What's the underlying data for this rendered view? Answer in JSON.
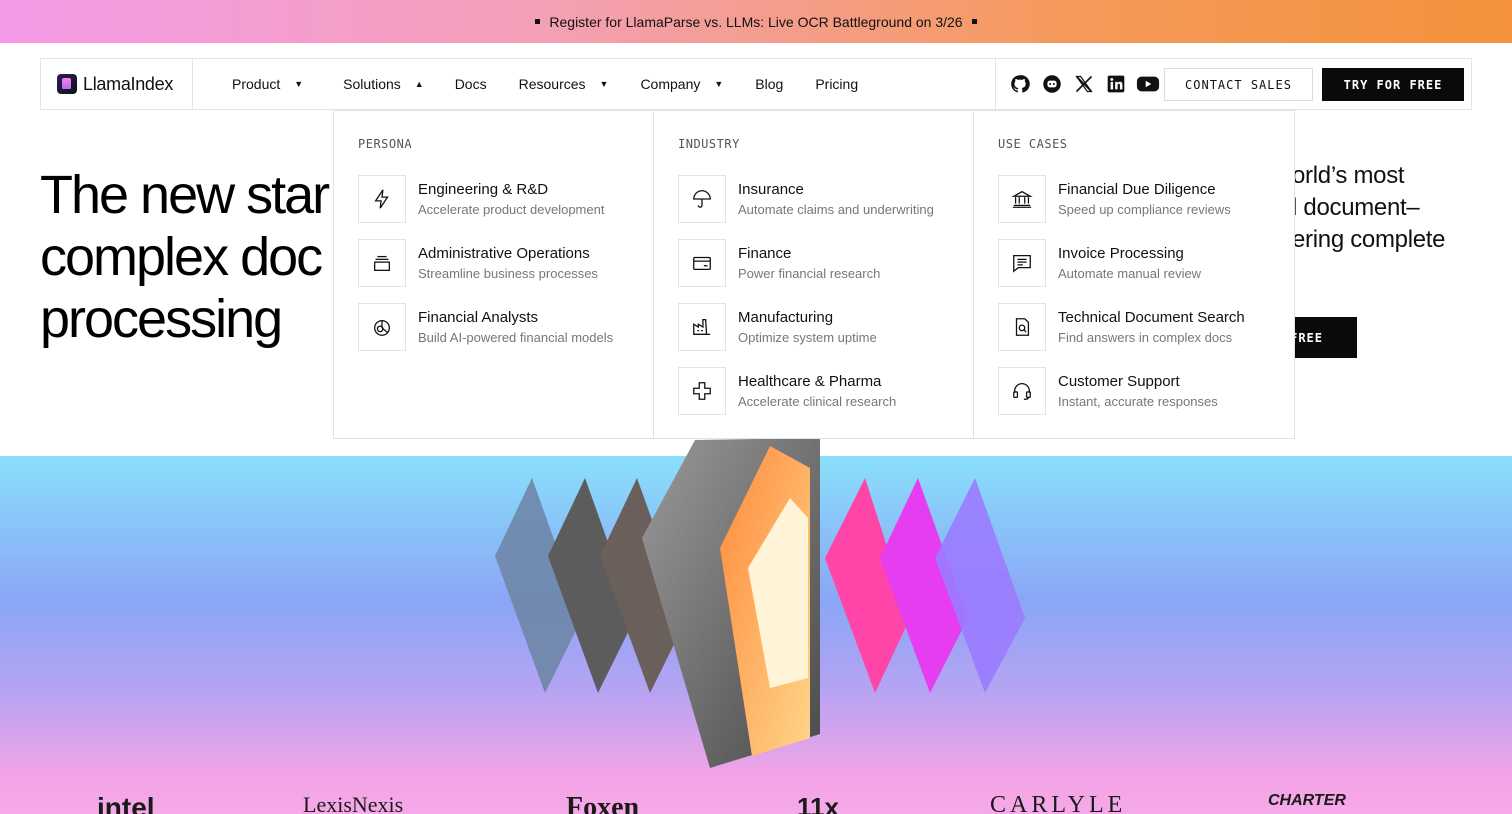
{
  "banner": {
    "text": "Register for LlamaParse vs. LLMs: Live OCR Battleground on 3/26"
  },
  "nav": {
    "logo_text": "LlamaIndex",
    "items": [
      {
        "label": "Product",
        "caret": "▼"
      },
      {
        "label": "Solutions",
        "caret": "▲"
      },
      {
        "label": "Docs"
      },
      {
        "label": "Resources",
        "caret": "▼"
      },
      {
        "label": "Company",
        "caret": "▼"
      },
      {
        "label": "Blog"
      },
      {
        "label": "Pricing"
      }
    ],
    "social_icons": [
      "github-icon",
      "discord-icon",
      "x-icon",
      "linkedin-icon",
      "youtube-icon"
    ],
    "contact_label": "CONTACT SALES",
    "try_label": "TRY FOR FREE"
  },
  "hero": {
    "title_lines": [
      "The new star",
      "complex doc",
      "processing"
    ],
    "sub_lines": [
      "orld’s most",
      "l document–",
      "ering complete"
    ],
    "cta_label": "FREE"
  },
  "dropdown": {
    "columns": [
      {
        "heading": "PERSONA",
        "items": [
          {
            "icon": "lightning-icon",
            "title": "Engineering & R&D",
            "desc": "Accelerate product development"
          },
          {
            "icon": "stack-icon",
            "title": "Administrative Operations",
            "desc": "Streamline business processes"
          },
          {
            "icon": "pie-chart-icon",
            "title": "Financial Analysts",
            "desc": "Build AI-powered financial models"
          }
        ]
      },
      {
        "heading": "INDUSTRY",
        "items": [
          {
            "icon": "umbrella-icon",
            "title": "Insurance",
            "desc": "Automate claims and underwriting"
          },
          {
            "icon": "credit-card-icon",
            "title": "Finance",
            "desc": "Power financial research"
          },
          {
            "icon": "factory-icon",
            "title": "Manufacturing",
            "desc": "Optimize system uptime"
          },
          {
            "icon": "medical-cross-icon",
            "title": "Healthcare & Pharma",
            "desc": "Accelerate clinical research"
          }
        ]
      },
      {
        "heading": "USE CASES",
        "items": [
          {
            "icon": "bank-icon",
            "title": "Financial Due Diligence",
            "desc": "Speed up compliance reviews"
          },
          {
            "icon": "receipt-icon",
            "title": "Invoice Processing",
            "desc": "Automate manual review"
          },
          {
            "icon": "document-search-icon",
            "title": "Technical Document Search",
            "desc": "Find answers in complex docs"
          },
          {
            "icon": "headset-icon",
            "title": "Customer Support",
            "desc": "Instant, accurate responses"
          }
        ]
      }
    ]
  },
  "customer_logos": [
    "intel",
    "LexisNexis",
    "Foxen",
    "11x",
    "CARLYLE",
    "CHARTER"
  ]
}
